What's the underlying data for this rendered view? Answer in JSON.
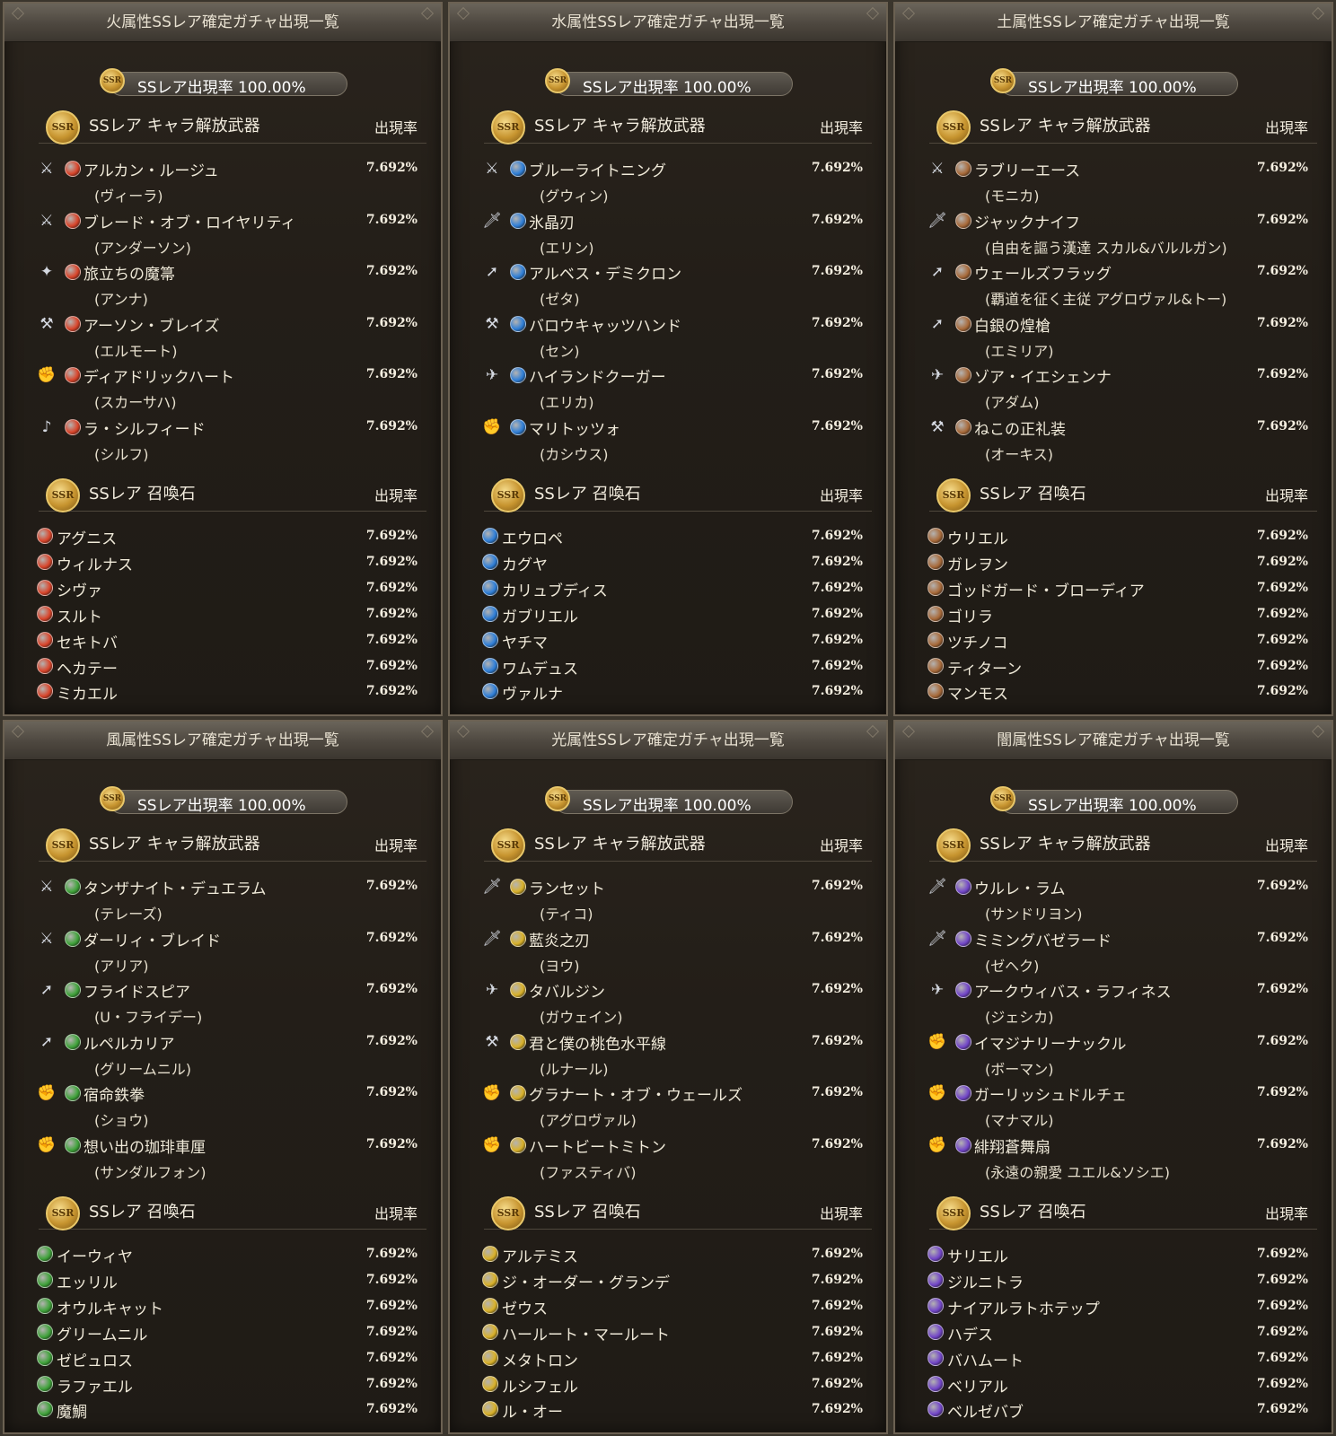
{
  "section_weapons_title": "SSレア キャラ解放武器",
  "section_summons_title": "SSレア 召喚石",
  "rate_header": "出現率",
  "pill_text": "SSレア出現率 100.00%",
  "item_rate": "7.692%",
  "medal_text": "SSR",
  "element_colors": {
    "fire": "#d9452b",
    "water": "#2f7fd8",
    "earth": "#a86a3a",
    "wind": "#3fa23a",
    "light": "#d9b12a",
    "dark": "#7246c8"
  },
  "panels": [
    {
      "title": "火属性SSレア確定ガチャ出現一覧",
      "element": "fire",
      "weapons": [
        {
          "name": "アルカン・ルージュ",
          "char": "(ヴィーラ)",
          "icon": "sword-icon"
        },
        {
          "name": "ブレード・オブ・ロイヤリティ",
          "char": "(アンダーソン)",
          "icon": "sword-icon"
        },
        {
          "name": "旅立ちの魔箒",
          "char": "(アンナ)",
          "icon": "staff-icon"
        },
        {
          "name": "アーソン・ブレイズ",
          "char": "(エルモート)",
          "icon": "axe-icon"
        },
        {
          "name": "ディアドリックハート",
          "char": "(スカーサハ)",
          "icon": "fist-icon"
        },
        {
          "name": "ラ・シルフィード",
          "char": "(シルフ)",
          "icon": "harp-icon"
        }
      ],
      "summons": [
        "アグニス",
        "ウィルナス",
        "シヴァ",
        "スルト",
        "セキトバ",
        "ヘカテー",
        "ミカエル"
      ]
    },
    {
      "title": "水属性SSレア確定ガチャ出現一覧",
      "element": "water",
      "weapons": [
        {
          "name": "ブルーライトニング",
          "char": "(グウィン)",
          "icon": "sword-icon"
        },
        {
          "name": "氷晶刃",
          "char": "(エリン)",
          "icon": "dagger-icon"
        },
        {
          "name": "アルベス・デミクロン",
          "char": "(ゼタ)",
          "icon": "spear-icon"
        },
        {
          "name": "バロウキャッツハンド",
          "char": "(セン)",
          "icon": "axe-icon"
        },
        {
          "name": "ハイランドクーガー",
          "char": "(エリカ)",
          "icon": "gun-icon"
        },
        {
          "name": "マリトッツォ",
          "char": "(カシウス)",
          "icon": "fist-icon"
        }
      ],
      "summons": [
        "エウロペ",
        "カグヤ",
        "カリュブディス",
        "ガブリエル",
        "ヤチマ",
        "ワムデュス",
        "ヴァルナ"
      ]
    },
    {
      "title": "土属性SSレア確定ガチャ出現一覧",
      "element": "earth",
      "weapons": [
        {
          "name": "ラブリーエース",
          "char": "(モニカ)",
          "icon": "sword-icon"
        },
        {
          "name": "ジャックナイフ",
          "char": "(自由を謳う漢達 スカル&バルルガン)",
          "icon": "dagger-icon"
        },
        {
          "name": "ウェールズフラッグ",
          "char": "(覇道を征く主従 アグロヴァル&トー)",
          "icon": "spear-icon"
        },
        {
          "name": "白銀の煌槍",
          "char": "(エミリア)",
          "icon": "spear-icon"
        },
        {
          "name": "ゾア・イエシェンナ",
          "char": "(アダム)",
          "icon": "gun-icon"
        },
        {
          "name": "ねこの正礼装",
          "char": "(オーキス)",
          "icon": "axe-icon"
        }
      ],
      "summons": [
        "ウリエル",
        "ガレヲン",
        "ゴッドガード・ブローディア",
        "ゴリラ",
        "ツチノコ",
        "ティターン",
        "マンモス"
      ]
    },
    {
      "title": "風属性SSレア確定ガチャ出現一覧",
      "element": "wind",
      "weapons": [
        {
          "name": "タンザナイト・デュエラム",
          "char": "(テレーズ)",
          "icon": "sword-icon"
        },
        {
          "name": "ダーリィ・ブレイド",
          "char": "(アリア)",
          "icon": "sword-icon"
        },
        {
          "name": "フライドスピア",
          "char": "(U・フライデー)",
          "icon": "spear-icon"
        },
        {
          "name": "ルペルカリア",
          "char": "(グリームニル)",
          "icon": "spear-icon"
        },
        {
          "name": "宿命鉄拳",
          "char": "(ショウ)",
          "icon": "fist-icon"
        },
        {
          "name": "想い出の珈琲車厘",
          "char": "(サンダルフォン)",
          "icon": "fist-icon"
        }
      ],
      "summons": [
        "イーウィヤ",
        "エッリル",
        "オウルキャット",
        "グリームニル",
        "ゼピュロス",
        "ラファエル",
        "魔鯛"
      ]
    },
    {
      "title": "光属性SSレア確定ガチャ出現一覧",
      "element": "light",
      "weapons": [
        {
          "name": "ランセット",
          "char": "(ティコ)",
          "icon": "dagger-icon"
        },
        {
          "name": "藍炎之刃",
          "char": "(ヨウ)",
          "icon": "dagger-icon"
        },
        {
          "name": "タバルジン",
          "char": "(ガウェイン)",
          "icon": "gun-icon"
        },
        {
          "name": "君と僕の桃色水平線",
          "char": "(ルナール)",
          "icon": "axe-icon"
        },
        {
          "name": "グラナート・オブ・ウェールズ",
          "char": "(アグロヴァル)",
          "icon": "fist-icon"
        },
        {
          "name": "ハートビートミトン",
          "char": "(ファスティバ)",
          "icon": "fist-icon"
        }
      ],
      "summons": [
        "アルテミス",
        "ジ・オーダー・グランデ",
        "ゼウス",
        "ハールート・マールート",
        "メタトロン",
        "ルシフェル",
        "ル・オー"
      ]
    },
    {
      "title": "闇属性SSレア確定ガチャ出現一覧",
      "element": "dark",
      "weapons": [
        {
          "name": "ウルレ・ラム",
          "char": "(サンドリヨン)",
          "icon": "dagger-icon"
        },
        {
          "name": "ミミングバゼラード",
          "char": "(ゼヘク)",
          "icon": "dagger-icon"
        },
        {
          "name": "アークウィバス・ラフィネス",
          "char": "(ジェシカ)",
          "icon": "gun-icon"
        },
        {
          "name": "イマジナリーナックル",
          "char": "(ボーマン)",
          "icon": "fist-icon"
        },
        {
          "name": "ガーリッシュドルチェ",
          "char": "(マナマル)",
          "icon": "fist-icon"
        },
        {
          "name": "緋翔蒼舞扇",
          "char": "(永遠の親愛 ユエル&ソシエ)",
          "icon": "fist-icon"
        }
      ],
      "summons": [
        "サリエル",
        "ジルニトラ",
        "ナイアルラトホテップ",
        "ハデス",
        "バハムート",
        "ベリアル",
        "ベルゼバブ"
      ]
    }
  ]
}
